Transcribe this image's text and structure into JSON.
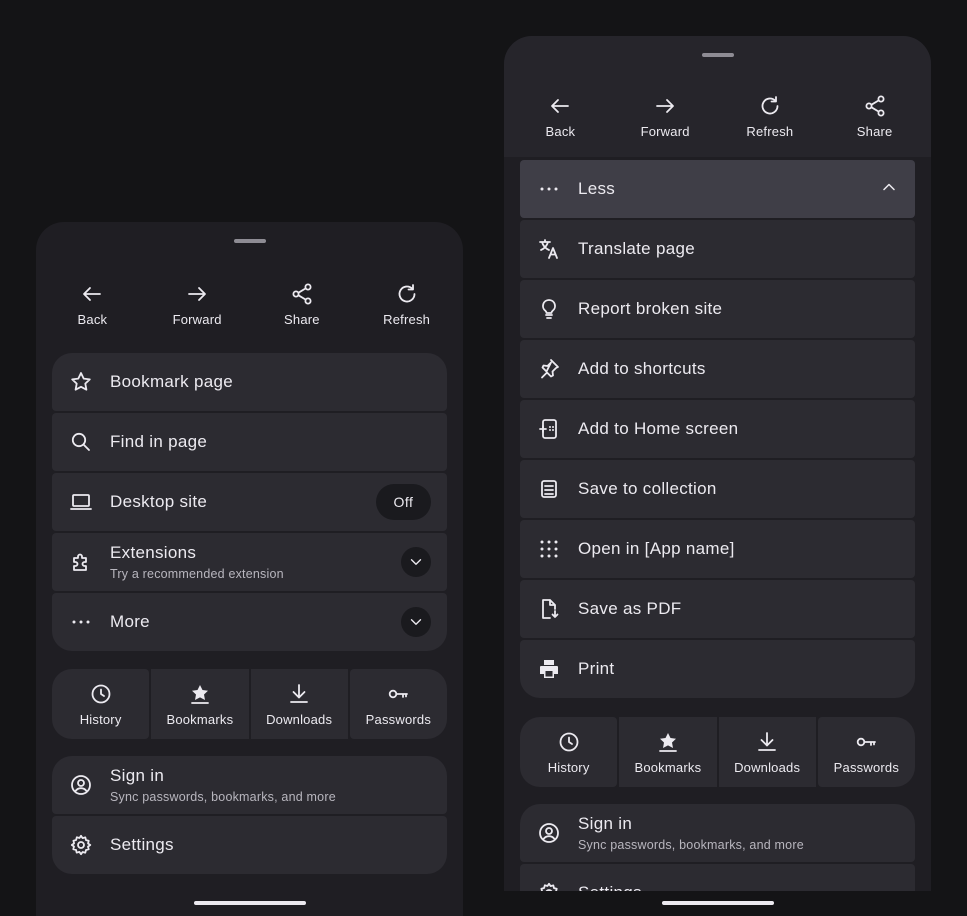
{
  "left_sheet": {
    "toolbar": [
      {
        "label": "Back",
        "icon": "arrow-left-icon"
      },
      {
        "label": "Forward",
        "icon": "arrow-right-icon"
      },
      {
        "label": "Share",
        "icon": "share-icon"
      },
      {
        "label": "Refresh",
        "icon": "refresh-icon"
      }
    ],
    "menu": [
      {
        "label": "Bookmark page",
        "icon": "star-outline-icon"
      },
      {
        "label": "Find in page",
        "icon": "search-icon"
      },
      {
        "label": "Desktop site",
        "icon": "laptop-icon",
        "toggle": "Off"
      },
      {
        "label": "Extensions",
        "sublabel": "Try a recommended extension",
        "icon": "puzzle-icon"
      },
      {
        "label": "More",
        "icon": "more-horizontal-icon"
      }
    ],
    "quick": [
      {
        "label": "History",
        "icon": "clock-icon"
      },
      {
        "label": "Bookmarks",
        "icon": "bookmark-star-icon"
      },
      {
        "label": "Downloads",
        "icon": "download-icon"
      },
      {
        "label": "Passwords",
        "icon": "key-icon"
      }
    ],
    "account": [
      {
        "label": "Sign in",
        "sublabel": "Sync passwords, bookmarks, and more",
        "icon": "account-circle-icon"
      },
      {
        "label": "Settings",
        "icon": "gear-icon"
      }
    ]
  },
  "right_sheet": {
    "toolbar": [
      {
        "label": "Back",
        "icon": "arrow-left-icon"
      },
      {
        "label": "Forward",
        "icon": "arrow-right-icon"
      },
      {
        "label": "Refresh",
        "icon": "refresh-icon"
      },
      {
        "label": "Share",
        "icon": "share-icon"
      }
    ],
    "menu": [
      {
        "label": "Less",
        "icon": "more-horizontal-icon"
      },
      {
        "label": "Translate page",
        "icon": "translate-icon"
      },
      {
        "label": "Report broken site",
        "icon": "lightbulb-icon"
      },
      {
        "label": "Add to shortcuts",
        "icon": "pin-icon"
      },
      {
        "label": "Add to Home screen",
        "icon": "add-home-screen-icon"
      },
      {
        "label": "Save to collection",
        "icon": "collection-icon"
      },
      {
        "label": "Open in [App name]",
        "icon": "grid-dots-icon"
      },
      {
        "label": "Save as PDF",
        "icon": "save-pdf-icon"
      },
      {
        "label": "Print",
        "icon": "printer-icon"
      }
    ],
    "quick": [
      {
        "label": "History",
        "icon": "clock-icon"
      },
      {
        "label": "Bookmarks",
        "icon": "bookmark-star-icon"
      },
      {
        "label": "Downloads",
        "icon": "download-icon"
      },
      {
        "label": "Passwords",
        "icon": "key-icon"
      }
    ],
    "account": [
      {
        "label": "Sign in",
        "sublabel": "Sync passwords, bookmarks, and more",
        "icon": "account-circle-icon"
      },
      {
        "label": "Settings",
        "icon": "gear-icon"
      }
    ]
  },
  "colors": {
    "background": "#141416",
    "sheet": "#1F1E23",
    "row": "#2C2B31",
    "row_active": "#3F3E47",
    "text": "#ECEAF0"
  }
}
